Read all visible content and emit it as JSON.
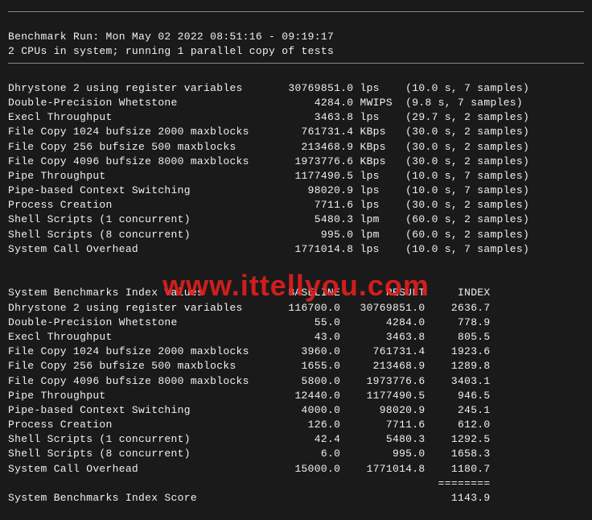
{
  "header": {
    "line1": "Benchmark Run: Mon May 02 2022 08:51:16 - 09:19:17",
    "line2": "2 CPUs in system; running 1 parallel copy of tests"
  },
  "section1": [
    {
      "name": "Dhrystone 2 using register variables",
      "value": "30769851.0",
      "unit": "lps",
      "timing": "(10.0 s, 7 samples)"
    },
    {
      "name": "Double-Precision Whetstone",
      "value": "4284.0",
      "unit": "MWIPS",
      "timing": "(9.8 s, 7 samples)"
    },
    {
      "name": "Execl Throughput",
      "value": "3463.8",
      "unit": "lps",
      "timing": "(29.7 s, 2 samples)"
    },
    {
      "name": "File Copy 1024 bufsize 2000 maxblocks",
      "value": "761731.4",
      "unit": "KBps",
      "timing": "(30.0 s, 2 samples)"
    },
    {
      "name": "File Copy 256 bufsize 500 maxblocks",
      "value": "213468.9",
      "unit": "KBps",
      "timing": "(30.0 s, 2 samples)"
    },
    {
      "name": "File Copy 4096 bufsize 8000 maxblocks",
      "value": "1973776.6",
      "unit": "KBps",
      "timing": "(30.0 s, 2 samples)"
    },
    {
      "name": "Pipe Throughput",
      "value": "1177490.5",
      "unit": "lps",
      "timing": "(10.0 s, 7 samples)"
    },
    {
      "name": "Pipe-based Context Switching",
      "value": "98020.9",
      "unit": "lps",
      "timing": "(10.0 s, 7 samples)"
    },
    {
      "name": "Process Creation",
      "value": "7711.6",
      "unit": "lps",
      "timing": "(30.0 s, 2 samples)"
    },
    {
      "name": "Shell Scripts (1 concurrent)",
      "value": "5480.3",
      "unit": "lpm",
      "timing": "(60.0 s, 2 samples)"
    },
    {
      "name": "Shell Scripts (8 concurrent)",
      "value": "995.0",
      "unit": "lpm",
      "timing": "(60.0 s, 2 samples)"
    },
    {
      "name": "System Call Overhead",
      "value": "1771014.8",
      "unit": "lps",
      "timing": "(10.0 s, 7 samples)"
    }
  ],
  "section2_header": {
    "label": "System Benchmarks Index Values",
    "col1": "BASELINE",
    "col2": "RESULT",
    "col3": "INDEX"
  },
  "section2": [
    {
      "name": "Dhrystone 2 using register variables",
      "baseline": "116700.0",
      "result": "30769851.0",
      "index": "2636.7"
    },
    {
      "name": "Double-Precision Whetstone",
      "baseline": "55.0",
      "result": "4284.0",
      "index": "778.9"
    },
    {
      "name": "Execl Throughput",
      "baseline": "43.0",
      "result": "3463.8",
      "index": "805.5"
    },
    {
      "name": "File Copy 1024 bufsize 2000 maxblocks",
      "baseline": "3960.0",
      "result": "761731.4",
      "index": "1923.6"
    },
    {
      "name": "File Copy 256 bufsize 500 maxblocks",
      "baseline": "1655.0",
      "result": "213468.9",
      "index": "1289.8"
    },
    {
      "name": "File Copy 4096 bufsize 8000 maxblocks",
      "baseline": "5800.0",
      "result": "1973776.6",
      "index": "3403.1"
    },
    {
      "name": "Pipe Throughput",
      "baseline": "12440.0",
      "result": "1177490.5",
      "index": "946.5"
    },
    {
      "name": "Pipe-based Context Switching",
      "baseline": "4000.0",
      "result": "98020.9",
      "index": "245.1"
    },
    {
      "name": "Process Creation",
      "baseline": "126.0",
      "result": "7711.6",
      "index": "612.0"
    },
    {
      "name": "Shell Scripts (1 concurrent)",
      "baseline": "42.4",
      "result": "5480.3",
      "index": "1292.5"
    },
    {
      "name": "Shell Scripts (8 concurrent)",
      "baseline": "6.0",
      "result": "995.0",
      "index": "1658.3"
    },
    {
      "name": "System Call Overhead",
      "baseline": "15000.0",
      "result": "1771014.8",
      "index": "1180.7"
    }
  ],
  "divider": "========",
  "footer": {
    "label": "System Benchmarks Index Score",
    "score": "1143.9"
  },
  "watermark_text": "www.ittellyou.com"
}
